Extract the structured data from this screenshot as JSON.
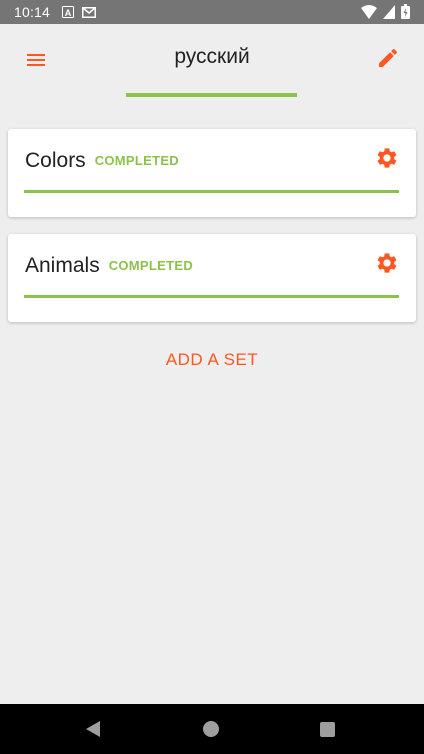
{
  "status_bar": {
    "time": "10:14",
    "left_icons": [
      "a-notification-icon",
      "gmail-icon"
    ],
    "right_icons": [
      "wifi-icon",
      "signal-icon",
      "battery-icon"
    ]
  },
  "header": {
    "title": "русский",
    "menu_icon": "hamburger-menu-icon",
    "edit_icon": "pencil-icon",
    "accent_color": "#ff5722",
    "underline_color": "#8bc34a"
  },
  "sets": [
    {
      "name": "Colors",
      "status": "COMPLETED",
      "progress": 1.0,
      "icon": "gear-icon"
    },
    {
      "name": "Animals",
      "status": "COMPLETED",
      "progress": 1.0,
      "icon": "gear-icon"
    }
  ],
  "add_set_label": "ADD A SET",
  "nav_bar": {
    "icons": [
      "back-icon",
      "home-icon",
      "recents-icon"
    ]
  }
}
